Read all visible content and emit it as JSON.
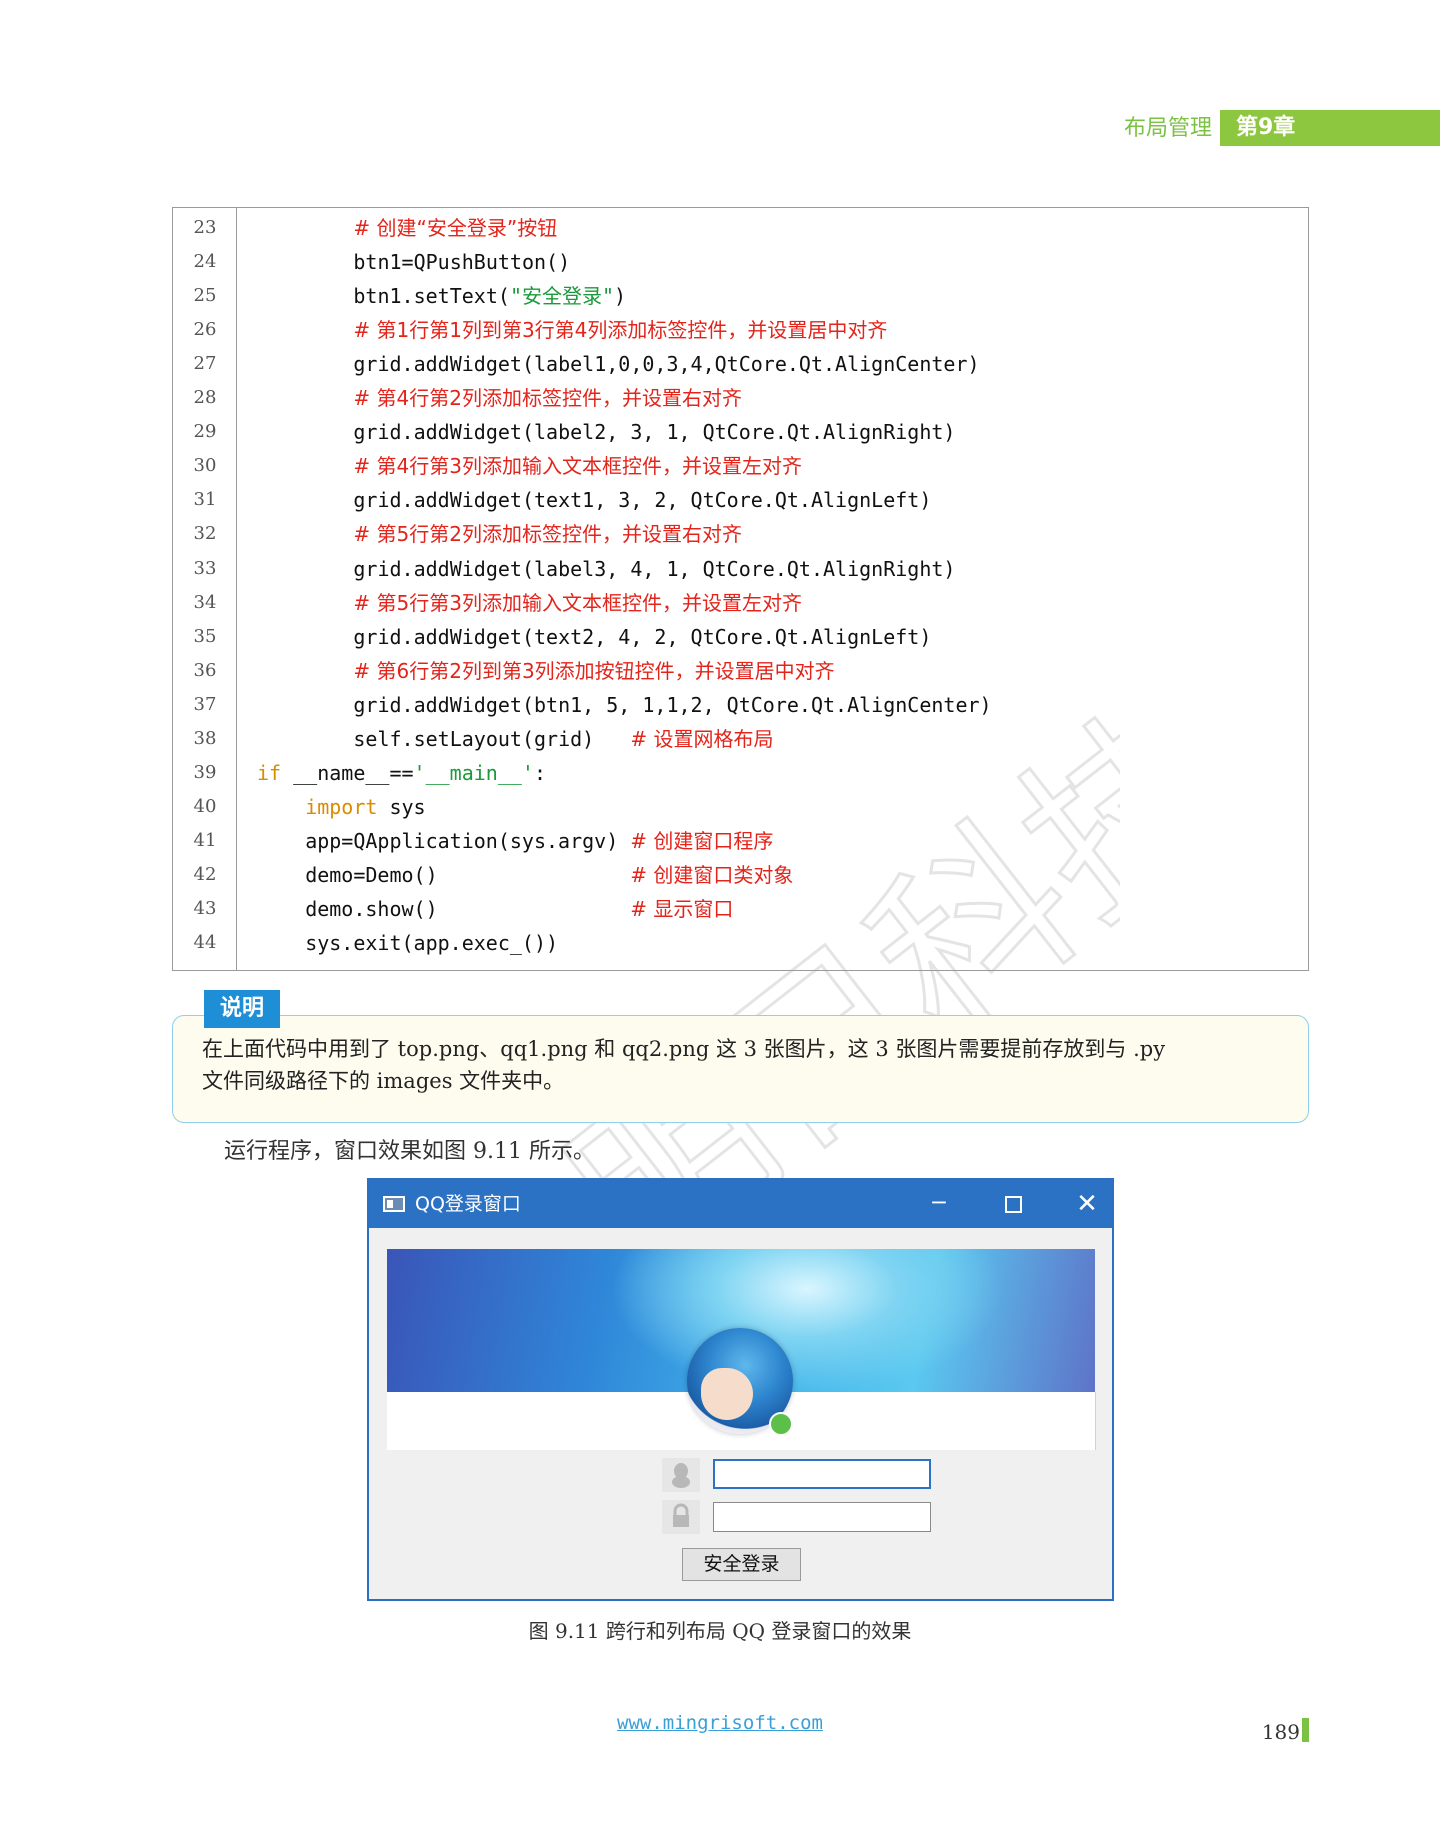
{
  "header": {
    "section": "布局管理",
    "chapter": "第9章"
  },
  "code": {
    "lines": [
      {
        "num": "23",
        "indent": 8,
        "parts": [
          {
            "t": "# 创建“安全登录”按钮",
            "k": "comment"
          }
        ]
      },
      {
        "num": "24",
        "indent": 8,
        "parts": [
          {
            "t": "btn1=QPushButton()",
            "k": "code"
          }
        ]
      },
      {
        "num": "25",
        "indent": 8,
        "parts": [
          {
            "t": "btn1.setText(",
            "k": "code"
          },
          {
            "t": "\"安全登录\"",
            "k": "str"
          },
          {
            "t": ")",
            "k": "code"
          }
        ]
      },
      {
        "num": "26",
        "indent": 8,
        "parts": [
          {
            "t": "# 第1行第1列到第3行第4列添加标签控件，并设置居中对齐",
            "k": "comment"
          }
        ]
      },
      {
        "num": "27",
        "indent": 8,
        "parts": [
          {
            "t": "grid.addWidget(label1,0,0,3,4,QtCore.Qt.AlignCenter)",
            "k": "code"
          }
        ]
      },
      {
        "num": "28",
        "indent": 8,
        "parts": [
          {
            "t": "# 第4行第2列添加标签控件，并设置右对齐",
            "k": "comment"
          }
        ]
      },
      {
        "num": "29",
        "indent": 8,
        "parts": [
          {
            "t": "grid.addWidget(label2, 3, 1, QtCore.Qt.AlignRight)",
            "k": "code"
          }
        ]
      },
      {
        "num": "30",
        "indent": 8,
        "parts": [
          {
            "t": "# 第4行第3列添加输入文本框控件，并设置左对齐",
            "k": "comment"
          }
        ]
      },
      {
        "num": "31",
        "indent": 8,
        "parts": [
          {
            "t": "grid.addWidget(text1, 3, 2, QtCore.Qt.AlignLeft)",
            "k": "code"
          }
        ]
      },
      {
        "num": "32",
        "indent": 8,
        "parts": [
          {
            "t": "# 第5行第2列添加标签控件，并设置右对齐",
            "k": "comment"
          }
        ]
      },
      {
        "num": "33",
        "indent": 8,
        "parts": [
          {
            "t": "grid.addWidget(label3, 4, 1, QtCore.Qt.AlignRight)",
            "k": "code"
          }
        ]
      },
      {
        "num": "34",
        "indent": 8,
        "parts": [
          {
            "t": "# 第5行第3列添加输入文本框控件，并设置左对齐",
            "k": "comment"
          }
        ]
      },
      {
        "num": "35",
        "indent": 8,
        "parts": [
          {
            "t": "grid.addWidget(text2, 4, 2, QtCore.Qt.AlignLeft)",
            "k": "code"
          }
        ]
      },
      {
        "num": "36",
        "indent": 8,
        "parts": [
          {
            "t": "# 第6行第2列到第3列添加按钮控件，并设置居中对齐",
            "k": "comment"
          }
        ]
      },
      {
        "num": "37",
        "indent": 8,
        "parts": [
          {
            "t": "grid.addWidget(btn1, 5, 1,1,2, QtCore.Qt.AlignCenter)",
            "k": "code"
          }
        ]
      },
      {
        "num": "38",
        "indent": 8,
        "parts": [
          {
            "t": "self.setLayout(grid)   ",
            "k": "code"
          },
          {
            "t": "# 设置网格布局",
            "k": "comment"
          }
        ]
      },
      {
        "num": "39",
        "indent": 0,
        "parts": [
          {
            "t": "if",
            "k": "kw"
          },
          {
            "t": " __name__==",
            "k": "code"
          },
          {
            "t": "'__main__'",
            "k": "str"
          },
          {
            "t": ":",
            "k": "code"
          }
        ]
      },
      {
        "num": "40",
        "indent": 4,
        "parts": [
          {
            "t": "import",
            "k": "kw"
          },
          {
            "t": " sys",
            "k": "code"
          }
        ]
      },
      {
        "num": "41",
        "indent": 4,
        "parts": [
          {
            "t": "app=QApplication(sys.argv) ",
            "k": "code"
          },
          {
            "t": "# 创建窗口程序",
            "k": "comment"
          }
        ]
      },
      {
        "num": "42",
        "indent": 4,
        "parts": [
          {
            "t": "demo=Demo()                ",
            "k": "code"
          },
          {
            "t": "# 创建窗口类对象",
            "k": "comment"
          }
        ]
      },
      {
        "num": "43",
        "indent": 4,
        "parts": [
          {
            "t": "demo.show()                ",
            "k": "code"
          },
          {
            "t": "# 显示窗口",
            "k": "comment"
          }
        ]
      },
      {
        "num": "44",
        "indent": 4,
        "parts": [
          {
            "t": "sys.exit(app.exec_())",
            "k": "code"
          }
        ]
      }
    ]
  },
  "note": {
    "tag": "说明",
    "line1": "在上面代码中用到了 top.png、qq1.png 和 qq2.png 这 3 张图片，这 3 张图片需要提前存放到与 .py",
    "line2": "文件同级路径下的 images 文件夹中。"
  },
  "run_text": "运行程序，窗口效果如图 9.11 所示。",
  "qq_window": {
    "title": "QQ登录窗口",
    "minimize": "─",
    "close": "✕",
    "login_button": "安全登录",
    "username_value": "",
    "password_value": ""
  },
  "caption": "图 9.11  跨行和列布局 QQ 登录窗口的效果",
  "footer": {
    "url": "www.mingrisoft.com",
    "page": "189"
  },
  "watermark_text": "明日科技"
}
